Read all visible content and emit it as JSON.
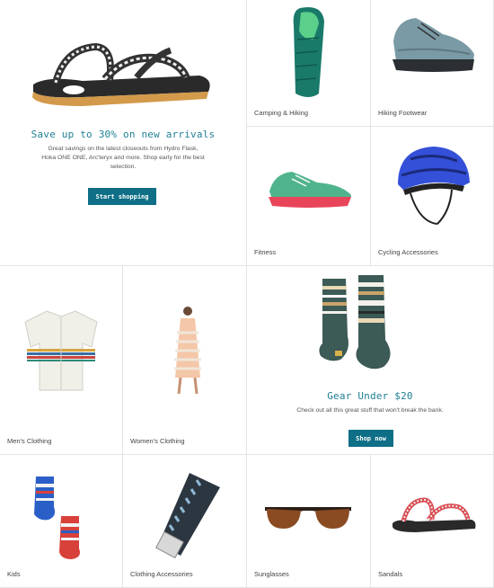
{
  "hero": {
    "title": "Save up to 30% on new arrivals",
    "description_line1": "Great savings on the latest closeouts from Hydro Flask,",
    "description_line2": "Hoka ONE ONE, Arc'teryx and more. Shop early for the best",
    "description_line3": "selection.",
    "button_label": "Start shopping",
    "product_icon": "sandal-icon"
  },
  "categories": {
    "camping": {
      "label": "Camping & Hiking",
      "icon": "sleeping-bag-icon"
    },
    "hiking_footwear": {
      "label": "Hiking Footwear",
      "icon": "hiking-shoe-icon"
    },
    "fitness": {
      "label": "Fitness",
      "icon": "running-shoe-icon"
    },
    "cycling": {
      "label": "Cycling Accessories",
      "icon": "bike-helmet-icon"
    },
    "mens": {
      "label": "Men's Clothing",
      "icon": "shirt-icon"
    },
    "womens": {
      "label": "Women's Clothing",
      "icon": "dress-icon"
    },
    "kids": {
      "label": "Kids",
      "icon": "kids-socks-icon"
    },
    "clothing_accessories": {
      "label": "Clothing Accessories",
      "icon": "belt-icon"
    },
    "sunglasses": {
      "label": "Sunglasses",
      "icon": "sunglasses-icon"
    },
    "sandals": {
      "label": "Sandals",
      "icon": "sandal-icon"
    }
  },
  "gear": {
    "title": "Gear Under $20",
    "description": "Check out all this great stuff that won't break the bank.",
    "button_label": "Shop now",
    "product_icon": "socks-icon"
  },
  "colors": {
    "accent": "#1f7f95",
    "button": "#0f6f86",
    "border": "#e3e3e3"
  }
}
